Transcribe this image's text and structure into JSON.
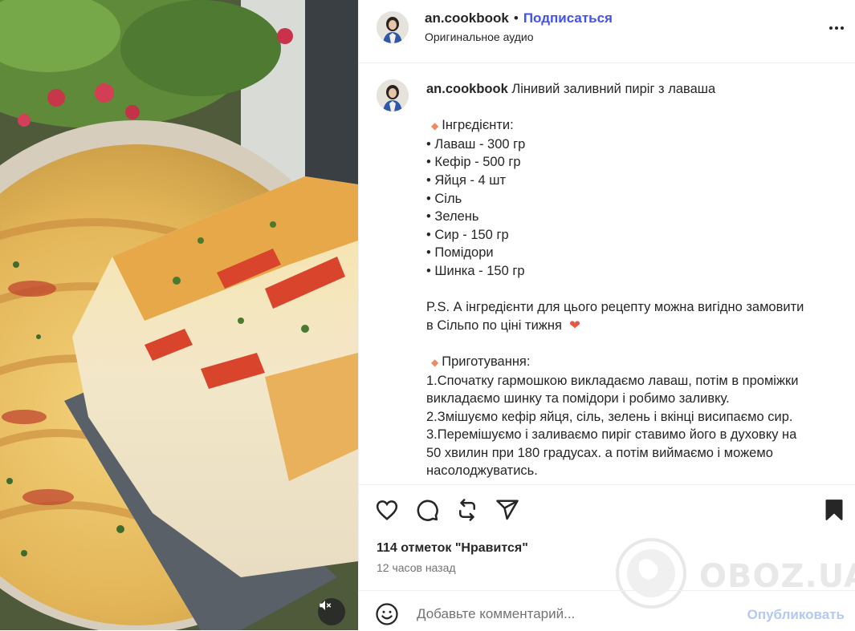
{
  "post": {
    "username": "an.cookbook",
    "separator": "•",
    "subscribe_label": "Подписаться",
    "audio_label": "Оригинальное аудио"
  },
  "caption": {
    "username": "an.cookbook",
    "title": "Лінивий заливний пиріг з лаваша",
    "ingredients_heading": "Інгрєдієнти:",
    "ingredients": [
      "• Лаваш - 300 гр",
      "• Кефір - 500 гр",
      "• Яйця - 4 шт",
      "• Сіль",
      "• Зелень",
      "• Сир - 150 гр",
      "• Помідори",
      "• Шинка - 150 гр"
    ],
    "ps_line1": "P.S. А інгредієнти для цього рецепту можна вигідно замовити",
    "ps_line2": "в Сільпо по ціні тижня",
    "steps_heading": "Приготування:",
    "steps": [
      "1.Спочатку гармошкою викладаємо лаваш, потім в проміжки",
      "викладаємо шинку та помідори і робимо заливку.",
      "2.Змішуємо кефір яйця, сіль, зелень і вкінці висипаємо сир.",
      "3.Перемішуємо і заливаємо пиріг ставимо його в духовку на",
      "50 хвилин при 180 градусах. а потім виймаємо і можемо",
      "насолоджуватись."
    ]
  },
  "stats": {
    "likes": "114 отметок \"Нравится\"",
    "time": "12 часов назад"
  },
  "comment": {
    "placeholder": "Добавьте комментарий...",
    "publish_label": "Опубликовать"
  },
  "watermark": {
    "text": "OBOZ.UA"
  },
  "icons": {
    "like": "heart-icon",
    "comment": "comment-icon",
    "repost": "repost-icon",
    "share": "share-icon",
    "save": "bookmark-icon",
    "emoji": "emoji-icon",
    "more": "more-icon",
    "mute": "mute-icon"
  },
  "colors": {
    "link_blue": "#4150f7",
    "publish_disabled": "#b2c9f5",
    "secondary_text": "#737373",
    "accent_diamond": "#f08a5d"
  }
}
